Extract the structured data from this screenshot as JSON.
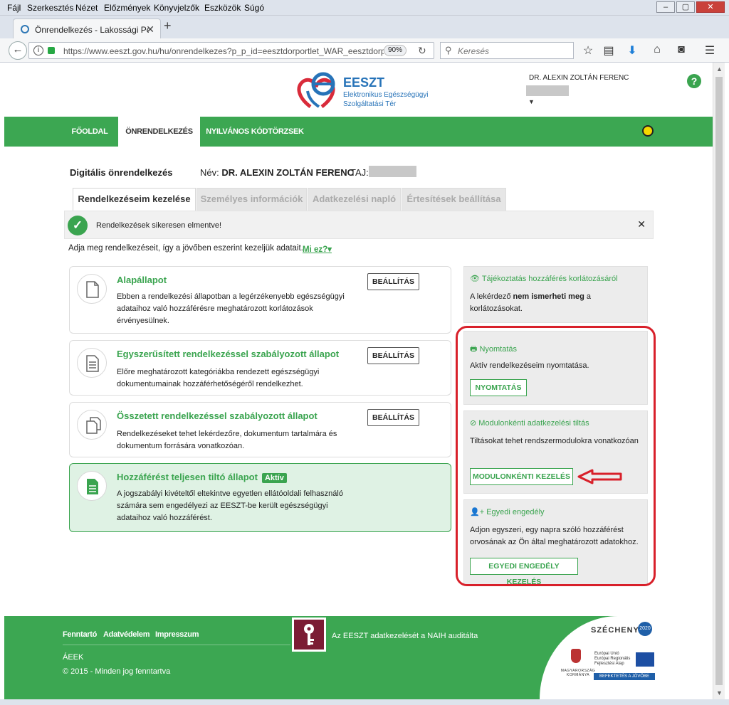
{
  "browser": {
    "menu": [
      "Fájl",
      "Szerkesztés",
      "Nézet",
      "Előzmények",
      "Könyvjelzők",
      "Eszközök",
      "Súgó"
    ],
    "tab_title": "Önrendelkezés - Lakossági Po",
    "url": "https://www.eeszt.gov.hu/hu/onrendelkezes?p_p_id=eesztdorportlet_WAR_eesztdorp",
    "zoom": "90%",
    "search_placeholder": "Keresés"
  },
  "header": {
    "logo_title": "EESZT",
    "logo_line1": "Elektronikus Egészségügyi",
    "logo_line2": "Szolgáltatási Tér",
    "user_name": "DR. ALEXIN ZOLTÁN FERENC",
    "help": "?"
  },
  "nav": {
    "items": [
      {
        "label": "FŐOLDAL"
      },
      {
        "label": "ÖNRENDELKEZÉS"
      },
      {
        "label": "NYILVÁNOS KÓDTÖRZSEK"
      }
    ]
  },
  "page": {
    "title": "Digitális önrendelkezés",
    "name_label": "Név:",
    "name_value": "DR. ALEXIN ZOLTÁN FERENC",
    "taj_label": "TAJ:",
    "tabs": [
      {
        "label": "Rendelkezéseim kezelése"
      },
      {
        "label": "Személyes információk"
      },
      {
        "label": "Adatkezelési napló"
      },
      {
        "label": "Értesítések beállítása"
      }
    ],
    "success_message": "Rendelkezések sikeresen elmentve!",
    "intro": "Adja meg rendelkezéseit, így a jövőben eszerint kezeljük adatait.",
    "what_is_it": "Mi ez?"
  },
  "cards": [
    {
      "title": "Alapállapot",
      "desc": "Ebben a rendelkezési állapotban a legérzékenyebb egészségügyi adataihoz való hozzáférésre meghatározott korlátozások érvényesülnek.",
      "button": "BEÁLLÍTÁS"
    },
    {
      "title": "Egyszerűsített rendelkezéssel szabályozott állapot",
      "desc": "Előre meghatározott kategóriákba rendezett egészségügyi dokumentumainak hozzáférhetőségéről rendelkezhet.",
      "button": "BEÁLLÍTÁS"
    },
    {
      "title": "Összetett rendelkezéssel szabályozott állapot",
      "desc": "Rendelkezéseket tehet lekérdezőre, dokumentum tartalmára és dokumentum forrására vonatkozóan.",
      "button": "BEÁLLÍTÁS"
    },
    {
      "title": "Hozzáférést teljesen tiltó állapot",
      "badge": "Aktív",
      "desc": "A jogszabályi kivételtől eltekintve egyetlen ellátóoldali felhasználó számára sem engedélyezi az EESZT-be került egészségügyi adataihoz való hozzáférést."
    }
  ],
  "side": {
    "info": {
      "title": "Tájékoztatás hozzáférés korlátozásáról",
      "desc_pre": "A lekérdező ",
      "desc_bold": "nem ismerheti meg",
      "desc_post": " a korlátozásokat."
    },
    "print": {
      "title": "Nyomtatás",
      "desc": "Aktív rendelkezéseim nyomtatása.",
      "button": "NYOMTATÁS"
    },
    "module": {
      "title": "Modulonkénti adatkezelési tiltás",
      "desc": "Tiltásokat tehet rendszermodulokra vonatkozóan",
      "button": "MODULONKÉNTI KEZELÉS"
    },
    "custom": {
      "title": "Egyedi engedély",
      "desc": "Adjon egyszeri, egy napra szóló hozzáférést orvosának az Ön által meghatározott adatokhoz.",
      "button": "EGYEDI ENGEDÉLY KEZELÉS"
    }
  },
  "footer": {
    "links": [
      "Fenntartó",
      "Adatvédelem",
      "Impresszum"
    ],
    "naih": "Az EESZT adatkezelését a NAIH auditálta",
    "org": "ÁEEK",
    "copyright": "© 2015 - Minden jog fenntartva",
    "szechenyi": "SZÉCHENYI",
    "year": "2020",
    "kormany": "MAGYARORSZÁG KORMÁNYA",
    "eu_line1": "Európai Unió",
    "eu_line2": "Európai Regionális Fejlesztési Alap",
    "befektetes": "BEFEKTETÉS A JÖVŐBE"
  },
  "colors": {
    "accent": "#3ca752",
    "highlight": "#d8202a"
  }
}
